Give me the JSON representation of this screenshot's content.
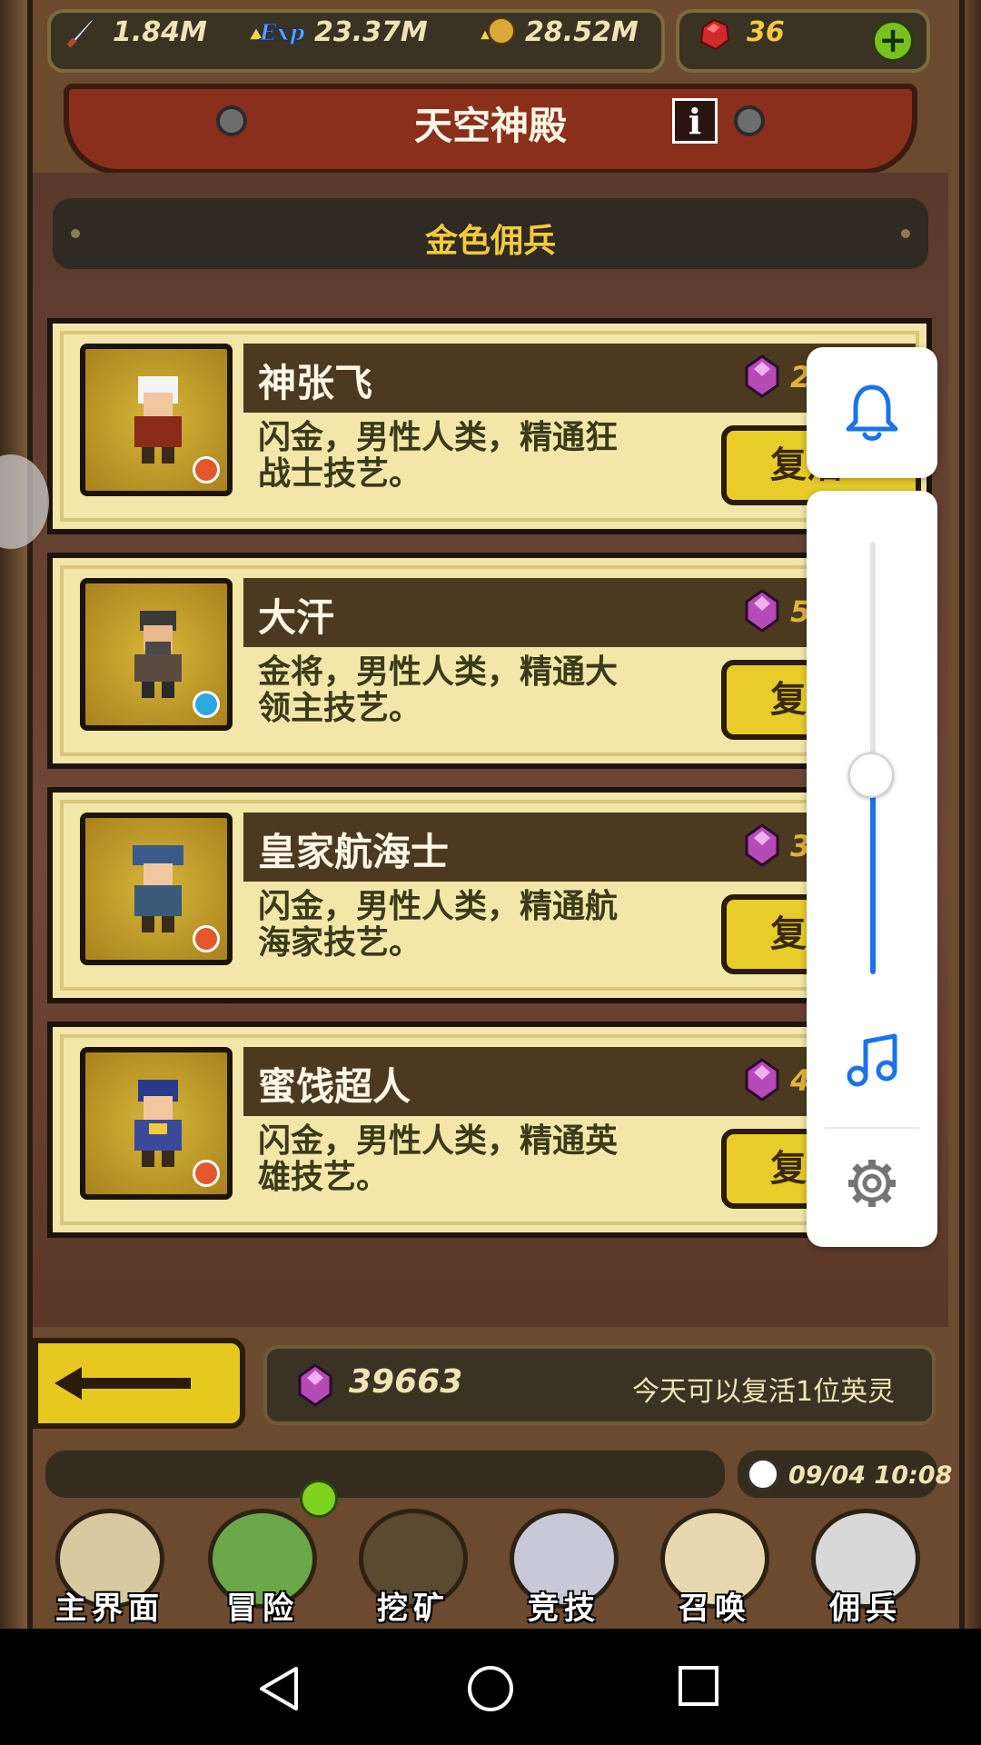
{
  "resources": {
    "attack": "1.84M",
    "exp": "23.37M",
    "gold": "28.52M",
    "rubies": "36"
  },
  "title": "天空神殿",
  "info_label": "i",
  "section_title": "金色佣兵",
  "heroes": [
    {
      "name": "神张飞",
      "desc": "闪金，男性人类，精通狂战士技艺。",
      "cost": "2",
      "button": "复活",
      "badge_color": "#e2582a"
    },
    {
      "name": "大汗",
      "desc": "金将，男性人类，精通大领主技艺。",
      "cost": "5",
      "button": "复活",
      "badge_color": "#2aa8e2"
    },
    {
      "name": "皇家航海士",
      "desc": "闪金，男性人类，精通航海家技艺。",
      "cost": "3",
      "button": "复活",
      "badge_color": "#e2582a"
    },
    {
      "name": "蜜饯超人",
      "desc": "闪金，男性人类，精通英雄技艺。",
      "cost": "4",
      "button": "复活",
      "badge_color": "#e2582a"
    }
  ],
  "footer": {
    "gems": "39663",
    "revive_info": "今天可以复活1位英灵"
  },
  "clock": "09/04 10:08",
  "nav": [
    "主界面",
    "冒险",
    "挖矿",
    "竞技",
    "召唤",
    "佣兵"
  ],
  "volume": {
    "level": 0.46
  },
  "colors": {
    "accent": "#1a73e8",
    "gold_button": "#e8cc2a",
    "card": "#f2e7a8"
  }
}
